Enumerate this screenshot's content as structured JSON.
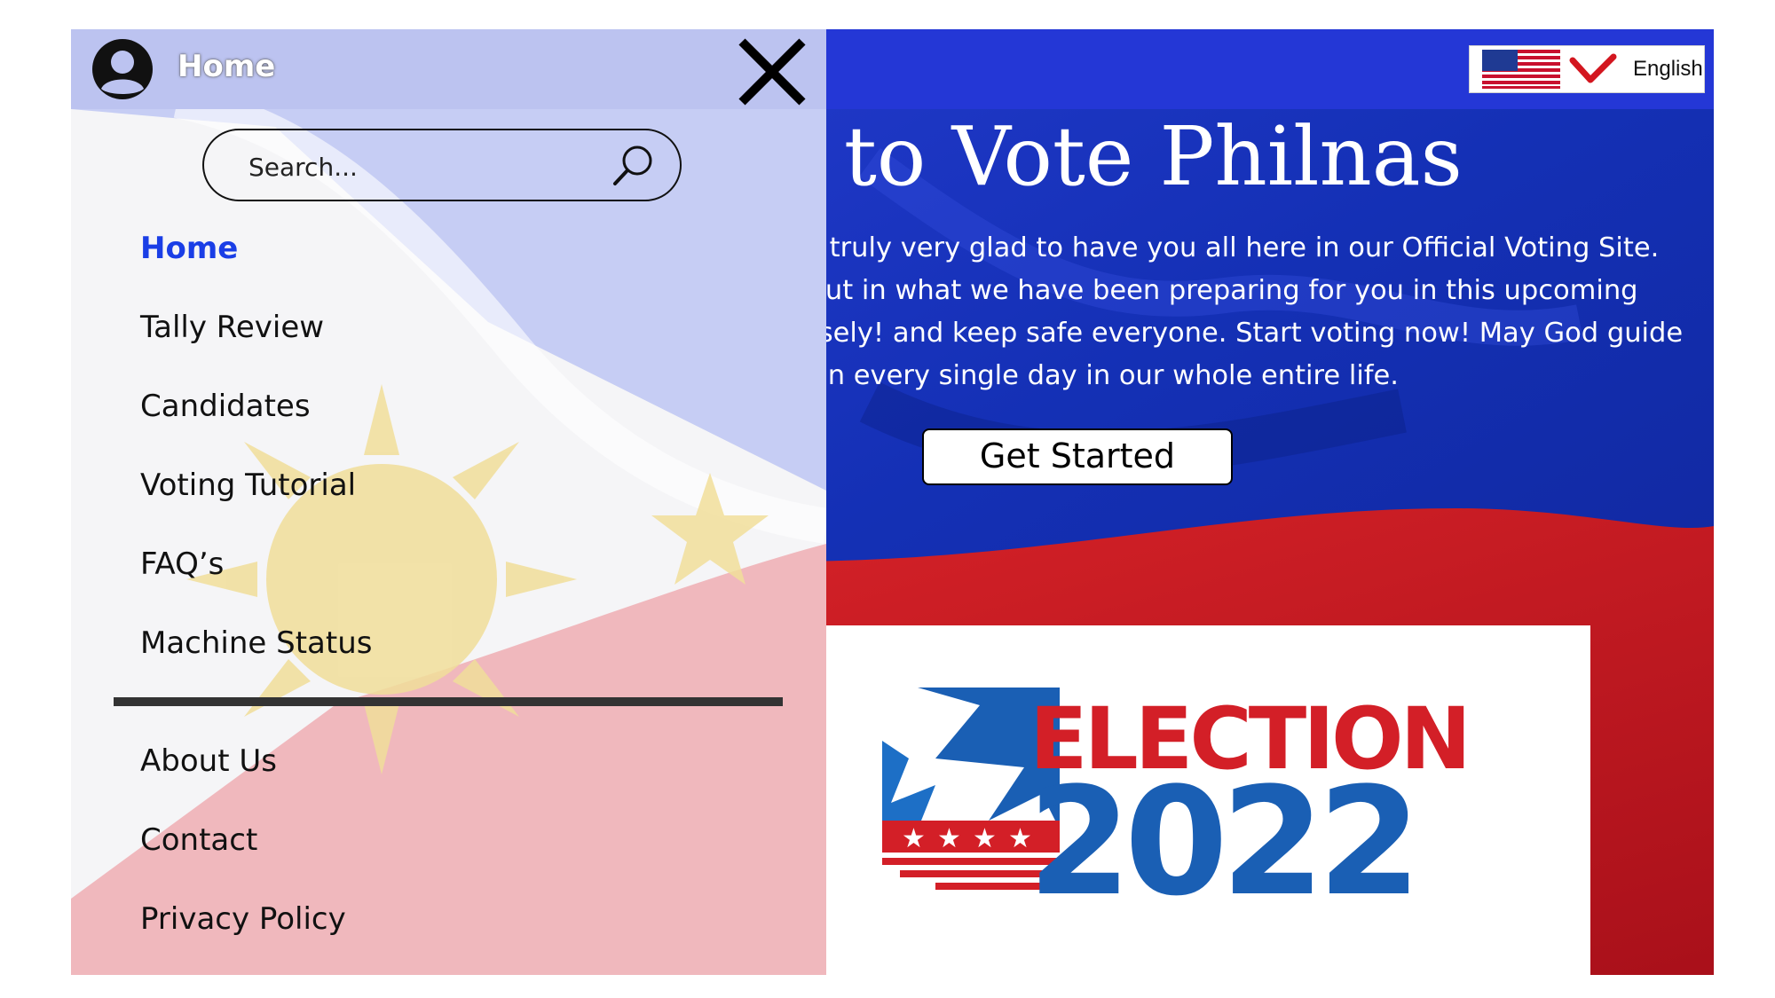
{
  "header": {
    "title": "Home",
    "close_icon": "close-icon",
    "avatar_icon": "user-avatar-icon"
  },
  "search": {
    "placeholder": "Search...",
    "icon": "search-icon"
  },
  "nav": {
    "items": [
      {
        "label": "Home",
        "active": true
      },
      {
        "label": "Tally Review"
      },
      {
        "label": "Candidates"
      },
      {
        "label": "Voting Tutorial"
      },
      {
        "label": "FAQ’s"
      },
      {
        "label": "Machine Status"
      }
    ],
    "secondary": [
      {
        "label": "About Us"
      },
      {
        "label": "Contact"
      },
      {
        "label": "Privacy Policy"
      }
    ]
  },
  "language": {
    "label": "English",
    "flag_icon": "us-flag-icon",
    "dropdown_icon": "chevron-down-icon"
  },
  "hero": {
    "title": "Welcome to Vote Philnas",
    "text": "Good Day Voters! We are truly very glad to have you all here in our Official Voting Site. Don’t miss everything out in what we have been preparing for you in this upcoming Election Day 2022, vote wisely! and keep safe everyone. Start voting now! May God guide us all in every single day in our whole entire life.",
    "cta": "Get Started"
  },
  "election_logo": {
    "word": "ELECTION",
    "year": "2022"
  },
  "colors": {
    "topbar": "#2437d6",
    "panel_header": "#bcc3f0",
    "active_nav": "#1a3ee6",
    "flag_red": "#d31b20",
    "logo_blue": "#1a5fb4",
    "logo_red": "#d31f27"
  }
}
